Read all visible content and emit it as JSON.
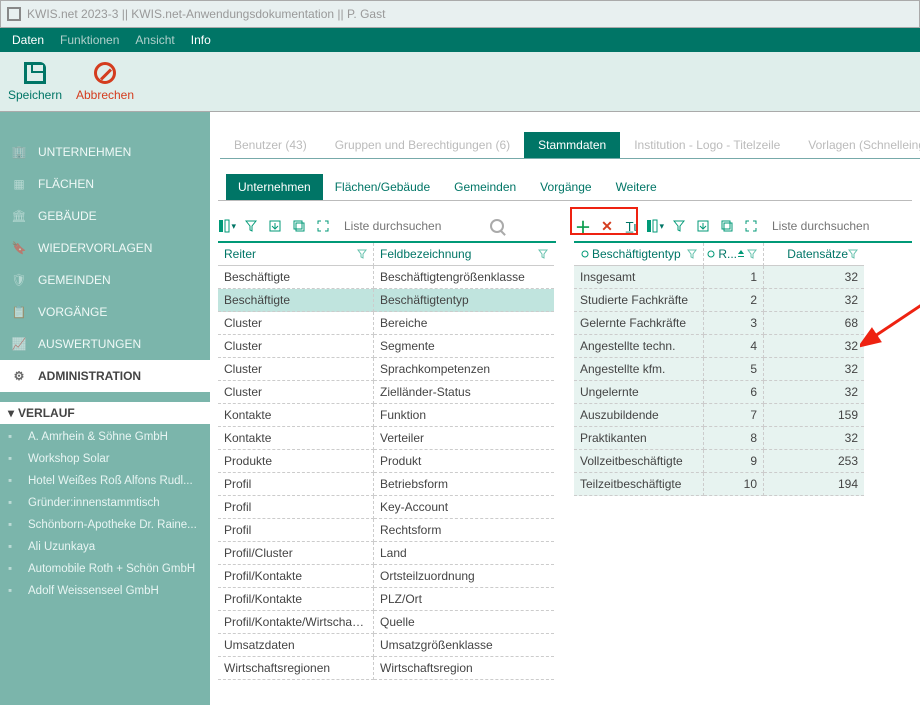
{
  "title": "KWIS.net 2023-3 || KWIS.net-Anwendungsdokumentation || P. Gast",
  "menu": {
    "items": [
      "Daten",
      "Funktionen",
      "Ansicht",
      "Info"
    ],
    "activeIndex": 0
  },
  "toolbar": {
    "save": "Speichern",
    "cancel": "Abbrechen"
  },
  "sidebar": {
    "items": [
      {
        "label": "UNTERNEHMEN"
      },
      {
        "label": "FLÄCHEN"
      },
      {
        "label": "GEBÄUDE"
      },
      {
        "label": "WIEDERVORLAGEN"
      },
      {
        "label": "GEMEINDEN"
      },
      {
        "label": "VORGÄNGE"
      },
      {
        "label": "AUSWERTUNGEN"
      },
      {
        "label": "ADMINISTRATION"
      }
    ],
    "activeIndex": 7,
    "history_header": "VERLAUF",
    "history": [
      "A. Amrhein & Söhne GmbH",
      "Workshop Solar",
      "Hotel Weißes Roß Alfons Rudl...",
      "Gründer:innenstammtisch",
      "Schönborn-Apotheke  Dr. Raine...",
      "Ali Uzunkaya",
      "Automobile Roth + Schön GmbH",
      "Adolf Weissenseel GmbH"
    ]
  },
  "top_tabs": {
    "items": [
      "Benutzer (43)",
      "Gruppen und Berechtigungen (6)",
      "Stammdaten",
      "Institution - Logo - Titelzeile",
      "Vorlagen (Schnelleingabe-"
    ],
    "activeIndex": 2
  },
  "sub_tabs": {
    "items": [
      "Unternehmen",
      "Flächen/Gebäude",
      "Gemeinden",
      "Vorgänge",
      "Weitere"
    ],
    "activeIndex": 0
  },
  "left_panel": {
    "search_placeholder": "Liste durchsuchen",
    "columns": [
      "Reiter",
      "Feldbezeichnung"
    ],
    "selectedIndex": 1,
    "rows": [
      [
        "Beschäftigte",
        "Beschäftigtengrößenklasse"
      ],
      [
        "Beschäftigte",
        "Beschäftigtentyp"
      ],
      [
        "Cluster",
        "Bereiche"
      ],
      [
        "Cluster",
        "Segmente"
      ],
      [
        "Cluster",
        "Sprachkompetenzen"
      ],
      [
        "Cluster",
        "Zielländer-Status"
      ],
      [
        "Kontakte",
        "Funktion"
      ],
      [
        "Kontakte",
        "Verteiler"
      ],
      [
        "Produkte",
        "Produkt"
      ],
      [
        "Profil",
        "Betriebsform"
      ],
      [
        "Profil",
        "Key-Account"
      ],
      [
        "Profil",
        "Rechtsform"
      ],
      [
        "Profil/Cluster",
        "Land"
      ],
      [
        "Profil/Kontakte",
        "Ortsteilzuordnung"
      ],
      [
        "Profil/Kontakte",
        "PLZ/Ort"
      ],
      [
        "Profil/Kontakte/Wirtschaftsr...",
        "Quelle"
      ],
      [
        "Umsatzdaten",
        "Umsatzgrößenklasse"
      ],
      [
        "Wirtschaftsregionen",
        "Wirtschaftsregion"
      ]
    ]
  },
  "right_panel": {
    "search_placeholder": "Liste durchsuchen",
    "columns": [
      "Beschäftigtentyp",
      "R...",
      "Datensätze"
    ],
    "rows": [
      [
        "Insgesamt",
        "1",
        "32"
      ],
      [
        "Studierte Fachkräfte",
        "2",
        "32"
      ],
      [
        "Gelernte Fachkräfte",
        "3",
        "68"
      ],
      [
        "Angestellte techn.",
        "4",
        "32"
      ],
      [
        "Angestellte kfm.",
        "5",
        "32"
      ],
      [
        "Ungelernte",
        "6",
        "32"
      ],
      [
        "Auszubildende",
        "7",
        "159"
      ],
      [
        "Praktikanten",
        "8",
        "32"
      ],
      [
        "Vollzeitbeschäftigte",
        "9",
        "253"
      ],
      [
        "Teilzeitbeschäftigte",
        "10",
        "194"
      ]
    ]
  }
}
